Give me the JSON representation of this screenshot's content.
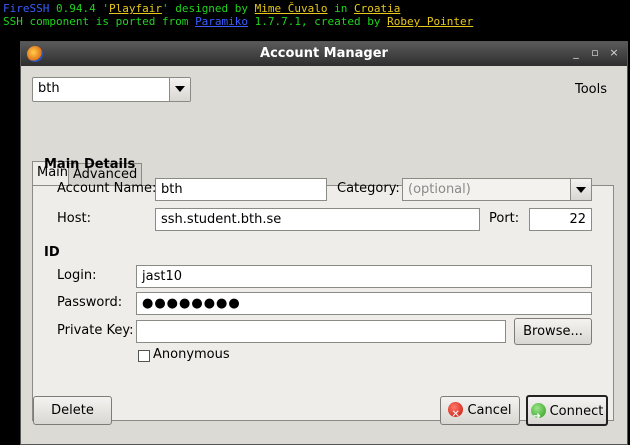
{
  "terminal": {
    "line1": {
      "app": "FireSSH",
      "version": " 0.94.4 '",
      "codename": "Playfair",
      "mid1": "' designed by ",
      "author": "Mime Čuvalo",
      "mid2": " in ",
      "country": "Croatia"
    },
    "line2": {
      "prefix": "SSH component is ported from ",
      "lib": "Paramiko",
      "mid": " 1.7.7.1, created by ",
      "author": "Robey Pointer"
    }
  },
  "window": {
    "title": "Account Manager",
    "controls": [
      "_",
      "▫",
      "×"
    ]
  },
  "account_select": {
    "value": "bth"
  },
  "tools_menu": "Tools",
  "tabs": [
    {
      "label": "Main",
      "active": true
    },
    {
      "label": "Advanced",
      "active": false
    }
  ],
  "main_details": {
    "heading": "Main Details",
    "account_name_label": "Account Name:",
    "account_name_value": "bth",
    "category_label": "Category:",
    "category_placeholder": "(optional)",
    "host_label": "Host:",
    "host_value": "ssh.student.bth.se",
    "port_label": "Port:",
    "port_value": "22"
  },
  "id_section": {
    "heading": "ID",
    "login_label": "Login:",
    "login_value": "jast10",
    "password_label": "Password:",
    "password_value": "●●●●●●●●",
    "private_key_label": "Private Key:",
    "private_key_value": "",
    "browse_label": "Browse...",
    "anonymous_label": "Anonymous",
    "anonymous_checked": false
  },
  "footer": {
    "delete_label": "Delete",
    "cancel_label": "Cancel",
    "connect_label": "Connect"
  }
}
